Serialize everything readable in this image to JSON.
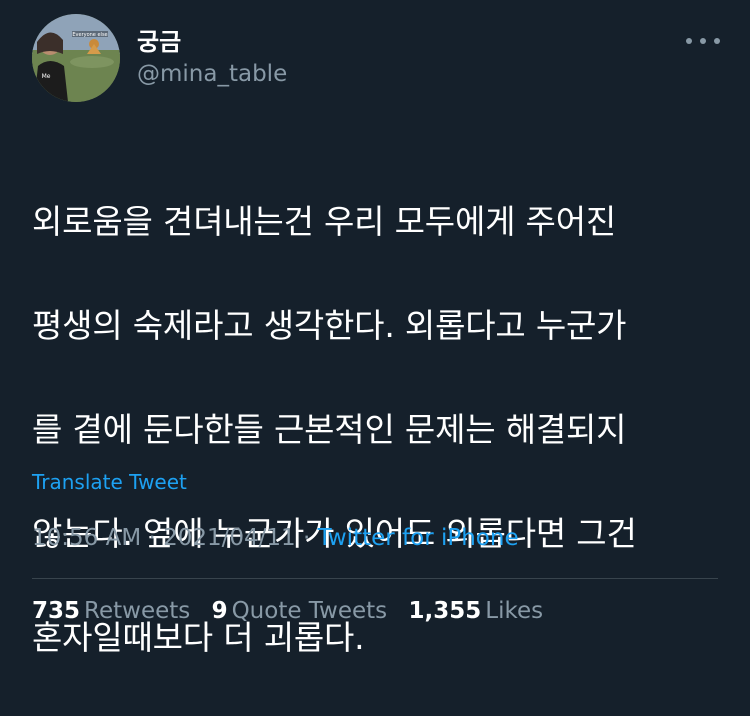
{
  "user": {
    "display_name": "궁금",
    "handle": "@mina_table",
    "avatar_caption_top": "Everyone else",
    "avatar_caption_side": "Me"
  },
  "tweet": {
    "text_lines": [
      "외로움을 견뎌내는건 우리 모두에게 주어진",
      "평생의 숙제라고 생각한다. 외롭다고 누군가",
      "를 곁에 둔다한들 근본적인 문제는 해결되지",
      "않는다. 옆에 누군가가 있어도 외롭다면 그건",
      "혼자일때보다 더 괴롭다."
    ],
    "translate_label": "Translate Tweet",
    "time": "10:56 AM",
    "separator": "·",
    "date": "2021/04/11",
    "source": "Twitter for iPhone"
  },
  "stats": {
    "retweets_count": "735",
    "retweets_label": "Retweets",
    "quotes_count": "9",
    "quotes_label": "Quote Tweets",
    "likes_count": "1,355",
    "likes_label": "Likes"
  },
  "colors": {
    "background": "#15202b",
    "text_primary": "#ffffff",
    "text_secondary": "#8899a6",
    "accent": "#1da1f2",
    "divider": "#38444d"
  },
  "icons": {
    "more": "more-dots-icon"
  }
}
